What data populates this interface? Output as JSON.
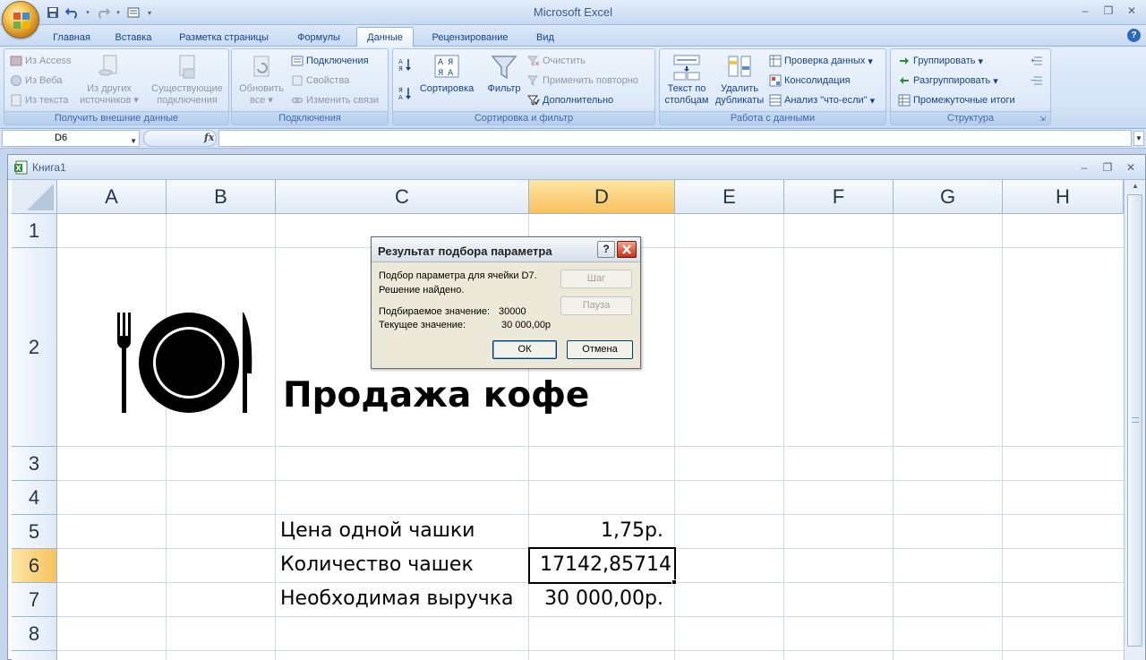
{
  "app": {
    "window_title": "Microsoft Excel"
  },
  "tabs": [
    {
      "label": "Главная",
      "active": false
    },
    {
      "label": "Вставка",
      "active": false
    },
    {
      "label": "Разметка страницы",
      "active": false
    },
    {
      "label": "Формулы",
      "active": false
    },
    {
      "label": "Данные",
      "active": true
    },
    {
      "label": "Рецензирование",
      "active": false
    },
    {
      "label": "Вид",
      "active": false
    }
  ],
  "ribbon": {
    "external": {
      "label": "Получить внешние данные",
      "from_access": "Из Access",
      "from_web": "Из Веба",
      "from_text": "Из текста",
      "other_sources_1": "Из других",
      "other_sources_2": "источников",
      "existing_1": "Существующие",
      "existing_2": "подключения"
    },
    "connections": {
      "label": "Подключения",
      "refresh_1": "Обновить",
      "refresh_2": "все",
      "connections": "Подключения",
      "properties": "Свойства",
      "edit_links": "Изменить связи"
    },
    "sort_filter": {
      "label": "Сортировка и фильтр",
      "sort": "Сортировка",
      "filter": "Фильтр",
      "clear": "Очистить",
      "reapply": "Применить повторно",
      "advanced": "Дополнительно"
    },
    "data_tools": {
      "label": "Работа с данными",
      "text_to_cols_1": "Текст по",
      "text_to_cols_2": "столбцам",
      "remove_dup_1": "Удалить",
      "remove_dup_2": "дубликаты",
      "validation": "Проверка данных",
      "consolidate": "Консолидация",
      "what_if": "Анализ \"что-если\""
    },
    "outline": {
      "label": "Структура",
      "group": "Группировать",
      "ungroup": "Разгруппировать",
      "subtotal": "Промежуточные итоги"
    }
  },
  "formula_bar": {
    "name_box": "D6",
    "fx": "fx",
    "content": ""
  },
  "workbook": {
    "name": "Книга1"
  },
  "grid": {
    "columns": [
      "A",
      "B",
      "C",
      "D",
      "E",
      "F",
      "G",
      "H"
    ],
    "rows": [
      "1",
      "2",
      "3",
      "4",
      "5",
      "6",
      "7",
      "8"
    ],
    "selected_column": "D",
    "selected_row": "6",
    "title": "Продажа кофе",
    "c5": "Цена одной чашки",
    "d5": "1,75р.",
    "c6": "Количество чашек",
    "d6": "17142,85714",
    "c7": "Необходимая выручка",
    "d7": "30 000,00р."
  },
  "dialog": {
    "title": "Результат подбора параметра",
    "help": "?",
    "line1": "Подбор параметра для ячейки D7.",
    "line2": "Решение найдено.",
    "target_label": "Подбираемое значение:",
    "target_value": "30000",
    "current_label": "Текущее значение:",
    "current_value": "30 000,00р",
    "step": "Шаг",
    "pause": "Пауза",
    "ok": "ОК",
    "cancel": "Отмена"
  },
  "colors": {
    "accent": "#15428b",
    "selected_header": "#f8c25c",
    "close_red": "#c9301a"
  },
  "icons": [
    "office-button-icon",
    "save-icon",
    "undo-icon",
    "redo-icon",
    "fork-plate-knife-icon",
    "excel-workbook-icon",
    "help-icon"
  ]
}
